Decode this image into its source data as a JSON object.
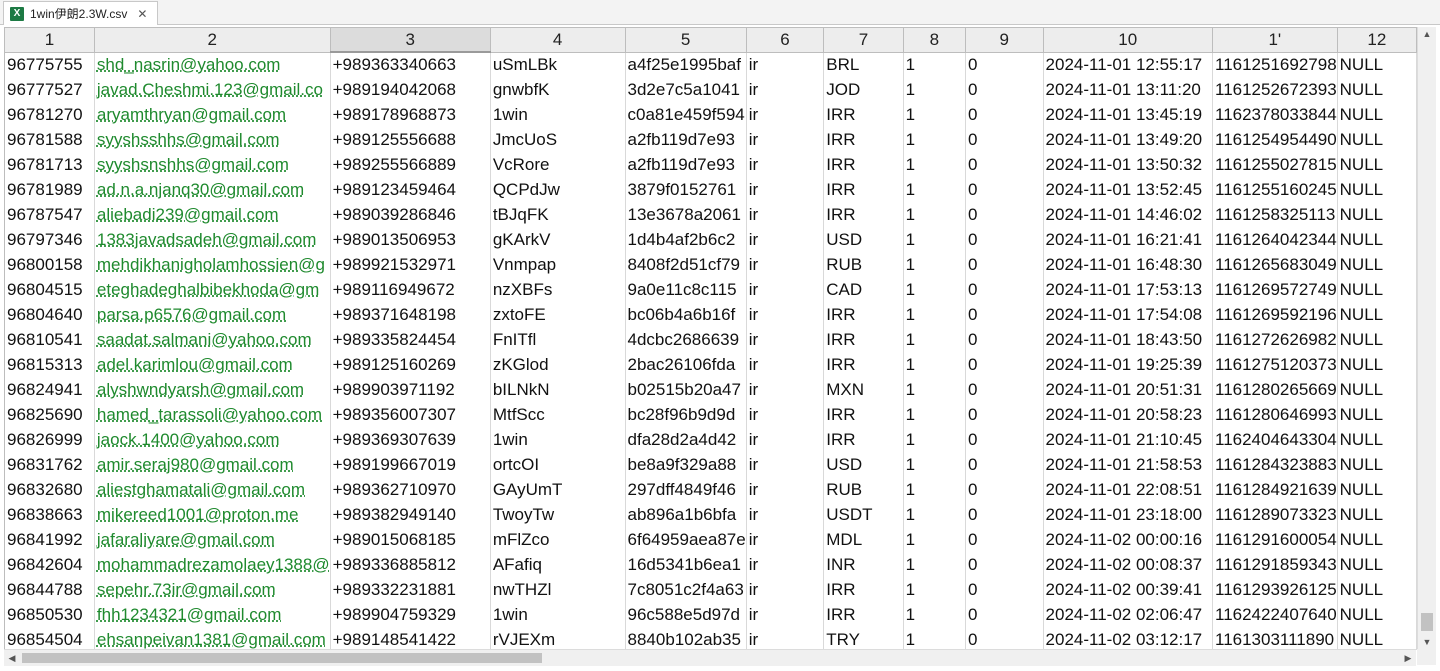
{
  "tab": {
    "icon": "excel-file-icon",
    "title": "1win伊朗2.3W.csv",
    "close": "✕"
  },
  "columns": [
    "1",
    "2",
    "3",
    "4",
    "5",
    "6",
    "7",
    "8",
    "9",
    "10",
    "1'",
    "12"
  ],
  "rows": [
    [
      "96775755",
      "shd_nasrin@yahoo.com",
      "+989363340663",
      "uSmLBk",
      "a4f25e1995baf",
      "ir",
      "BRL",
      "1",
      "0",
      "2024-11-01 12:55:17",
      "1161251692798",
      "NULL"
    ],
    [
      "96777527",
      "javad.Cheshmi.123@gmail.co",
      "+989194042068",
      "gnwbfK",
      "3d2e7c5a1041",
      "ir",
      "JOD",
      "1",
      "0",
      "2024-11-01 13:11:20",
      "1161252672393",
      "NULL"
    ],
    [
      "96781270",
      "aryamthryan@gmail.com",
      "+989178968873",
      "1win",
      "c0a81e459f594",
      "ir",
      "IRR",
      "1",
      "0",
      "2024-11-01 13:45:19",
      "1162378033844",
      "NULL"
    ],
    [
      "96781588",
      "syyshsshhs@gmail.com",
      "+989125556688",
      "JmcUoS",
      "a2fb119d7e93",
      "ir",
      "IRR",
      "1",
      "0",
      "2024-11-01 13:49:20",
      "1161254954490",
      "NULL"
    ],
    [
      "96781713",
      "syyshsnshhs@gmail.com",
      "+989255566889",
      "VcRore",
      "a2fb119d7e93",
      "ir",
      "IRR",
      "1",
      "0",
      "2024-11-01 13:50:32",
      "1161255027815",
      "NULL"
    ],
    [
      "96781989",
      "ad.n.a.njanq30@gmail.com",
      "+989123459464",
      "QCPdJw",
      "3879f0152761",
      "ir",
      "IRR",
      "1",
      "0",
      "2024-11-01 13:52:45",
      "1161255160245",
      "NULL"
    ],
    [
      "96787547",
      "aliebadi239@gmail.com",
      "+989039286846",
      "tBJqFK",
      "13e3678a2061",
      "ir",
      "IRR",
      "1",
      "0",
      "2024-11-01 14:46:02",
      "1161258325113",
      "NULL"
    ],
    [
      "96797346",
      "1383javadsadeh@gmail.com",
      "+989013506953",
      "gKArkV",
      "1d4b4af2b6c2",
      "ir",
      "USD",
      "1",
      "0",
      "2024-11-01 16:21:41",
      "1161264042344",
      "NULL"
    ],
    [
      "96800158",
      "mehdikhanigholamhossien@g",
      "+989921532971",
      "Vnmpap",
      "8408f2d51cf79",
      "ir",
      "RUB",
      "1",
      "0",
      "2024-11-01 16:48:30",
      "1161265683049",
      "NULL"
    ],
    [
      "96804515",
      "eteghadeghalbibekhoda@gm",
      "+989116949672",
      "nzXBFs",
      "9a0e11c8c115",
      "ir",
      "CAD",
      "1",
      "0",
      "2024-11-01 17:53:13",
      "1161269572749",
      "NULL"
    ],
    [
      "96804640",
      "parsa.p6576@gmail.com",
      "+989371648198",
      "zxtoFE",
      "bc06b4a6b16f",
      "ir",
      "IRR",
      "1",
      "0",
      "2024-11-01 17:54:08",
      "1161269592196",
      "NULL"
    ],
    [
      "96810541",
      "saadat.salmani@yahoo.com",
      "+989335824454",
      "FnITfl",
      "4dcbc2686639",
      "ir",
      "IRR",
      "1",
      "0",
      "2024-11-01 18:43:50",
      "1161272626982",
      "NULL"
    ],
    [
      "96815313",
      "adel.karimlou@gmail.com",
      "+989125160269",
      "zKGlod",
      "2bac26106fda",
      "ir",
      "IRR",
      "1",
      "0",
      "2024-11-01 19:25:39",
      "1161275120373",
      "NULL"
    ],
    [
      "96824941",
      "alyshwndyarsh@gmail.com",
      "+989903971192",
      "bILNkN",
      "b02515b20a47",
      "ir",
      "MXN",
      "1",
      "0",
      "2024-11-01 20:51:31",
      "1161280265669",
      "NULL"
    ],
    [
      "96825690",
      "hamed_tarassoli@yahoo.com",
      "+989356007307",
      "MtfScc",
      "bc28f96b9d9d",
      "ir",
      "IRR",
      "1",
      "0",
      "2024-11-01 20:58:23",
      "1161280646993",
      "NULL"
    ],
    [
      "96826999",
      "jaock.1400@yahoo.com",
      "+989369307639",
      "1win",
      "dfa28d2a4d42",
      "ir",
      "IRR",
      "1",
      "0",
      "2024-11-01 21:10:45",
      "1162404643304",
      "NULL"
    ],
    [
      "96831762",
      "amir.seraj980@gmail.com",
      "+989199667019",
      "ortcOI",
      "be8a9f329a88",
      "ir",
      "USD",
      "1",
      "0",
      "2024-11-01 21:58:53",
      "1161284323883",
      "NULL"
    ],
    [
      "96832680",
      "aliestghamatali@gmail.com",
      "+989362710970",
      "GAyUmT",
      "297dff4849f46",
      "ir",
      "RUB",
      "1",
      "0",
      "2024-11-01 22:08:51",
      "1161284921639",
      "NULL"
    ],
    [
      "96838663",
      "mikereed1001@proton.me",
      "+989382949140",
      "TwoyTw",
      "ab896a1b6bfa",
      "ir",
      "USDT",
      "1",
      "0",
      "2024-11-01 23:18:00",
      "1161289073323",
      "NULL"
    ],
    [
      "96841992",
      "jafaraliyare@gmail.com",
      "+989015068185",
      "mFlZco",
      "6f64959aea87e",
      "ir",
      "MDL",
      "1",
      "0",
      "2024-11-02 00:00:16",
      "1161291600054",
      "NULL"
    ],
    [
      "96842604",
      "mohammadrezamolaey1388@",
      "+989336885812",
      "AFafiq",
      "16d5341b6ea1",
      "ir",
      "INR",
      "1",
      "0",
      "2024-11-02 00:08:37",
      "1161291859343",
      "NULL"
    ],
    [
      "96844788",
      "sepehr.73ir@gmail.com",
      "+989332231881",
      "nwTHZl",
      "7c8051c2f4a63",
      "ir",
      "IRR",
      "1",
      "0",
      "2024-11-02 00:39:41",
      "1161293926125",
      "NULL"
    ],
    [
      "96850530",
      "fhh1234321@gmail.com",
      "+989904759329",
      "1win",
      "96c588e5d97d",
      "ir",
      "IRR",
      "1",
      "0",
      "2024-11-02 02:06:47",
      "1162422407640",
      "NULL"
    ],
    [
      "96854504",
      "ehsanpeivan1381@gmail.com",
      "+989148541422",
      "rVJEXm",
      "8840b102ab35",
      "ir",
      "TRY",
      "1",
      "0",
      "2024-11-02 03:12:17",
      "1161303111890",
      "NULL"
    ]
  ],
  "scrollbars": {
    "up": "▲",
    "down": "▼",
    "left": "◀",
    "right": "▶"
  }
}
